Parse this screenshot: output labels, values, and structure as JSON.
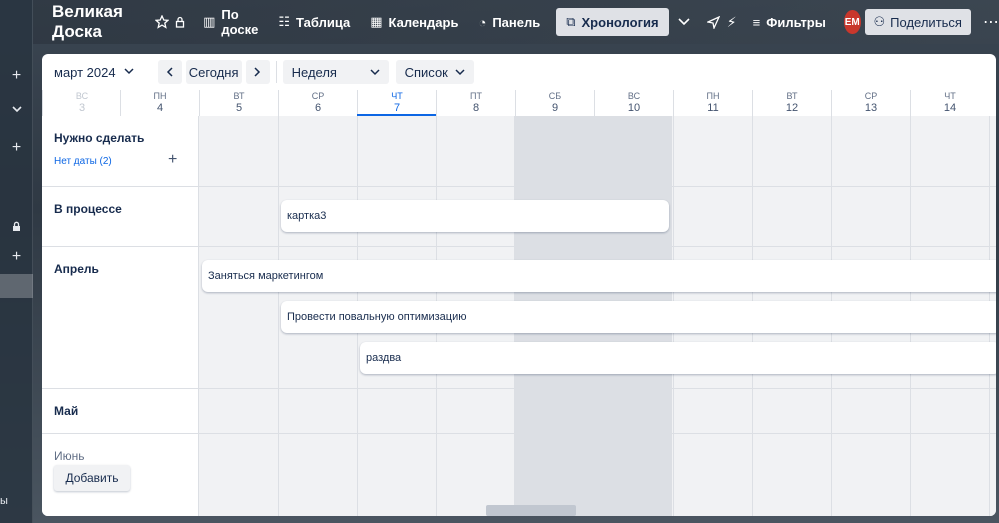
{
  "board": {
    "title": "Великая Доска"
  },
  "header": {
    "by_board": "По доске",
    "table": "Таблица",
    "calendar": "Календарь",
    "panel": "Панель",
    "timeline": "Хронология",
    "filters": "Фильтры",
    "avatar_initials": "EM",
    "share": "Поделиться"
  },
  "sidebar": {
    "bottom_text": "ы"
  },
  "toolbar": {
    "month": "март 2024",
    "today": "Сегодня",
    "week": "Неделя",
    "list": "Список"
  },
  "days": [
    {
      "wd": "ВС",
      "dn": "3"
    },
    {
      "wd": "ПН",
      "dn": "4"
    },
    {
      "wd": "ВТ",
      "dn": "5"
    },
    {
      "wd": "СР",
      "dn": "6"
    },
    {
      "wd": "ЧТ",
      "dn": "7"
    },
    {
      "wd": "ПТ",
      "dn": "8"
    },
    {
      "wd": "СБ",
      "dn": "9"
    },
    {
      "wd": "ВС",
      "dn": "10"
    },
    {
      "wd": "ПН",
      "dn": "11"
    },
    {
      "wd": "ВТ",
      "dn": "12"
    },
    {
      "wd": "СР",
      "dn": "13"
    },
    {
      "wd": "ЧТ",
      "dn": "14"
    }
  ],
  "groups": {
    "todo": "Нужно сделать",
    "no_date": "Нет даты (2)",
    "in_progress": "В процессе",
    "april": "Апрель",
    "may": "Май",
    "june": "Июнь"
  },
  "cards": {
    "card3": "картка3",
    "marketing": "Заняться маркетингом",
    "optimization": "Провести повальную оптимизацию",
    "razdva": "раздва"
  },
  "footer": {
    "add": "Добавить"
  }
}
